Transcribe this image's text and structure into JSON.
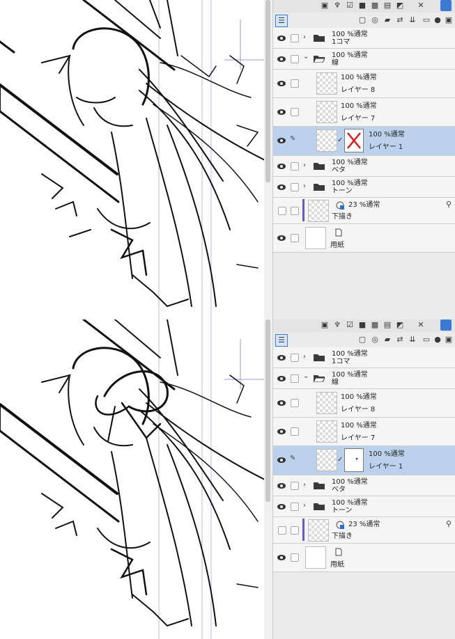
{
  "panels": [
    {
      "id": "before",
      "toggle_x": "✕",
      "layers": [
        {
          "kind": "folder",
          "indent": 0,
          "expanded": false,
          "line1": "100 %通常",
          "line2": "1コマ",
          "selected": false
        },
        {
          "kind": "folder",
          "indent": 0,
          "expanded": true,
          "line1": "100 %通常",
          "line2": "線",
          "selected": false
        },
        {
          "kind": "raster",
          "indent": 1,
          "line1": "100 %通常",
          "line2": "レイヤー 8",
          "selected": false
        },
        {
          "kind": "raster",
          "indent": 1,
          "line1": "100 %通常",
          "line2": "レイヤー 7",
          "selected": false
        },
        {
          "kind": "raster-mask",
          "indent": 1,
          "line1": "100 %通常",
          "line2": "レイヤー 1",
          "selected": true,
          "mask": "x"
        },
        {
          "kind": "folder",
          "indent": 0,
          "expanded": false,
          "line1": "100 %通常",
          "line2": "ベタ",
          "selected": false
        },
        {
          "kind": "folder",
          "indent": 0,
          "expanded": false,
          "line1": "100 %通常",
          "line2": "トーン",
          "selected": false
        },
        {
          "kind": "draft",
          "indent": 0,
          "line1": "23 %通常",
          "line2": "下描き",
          "selected": false
        },
        {
          "kind": "paper",
          "indent": 0,
          "line1": "",
          "line2": "用紙",
          "selected": false
        }
      ]
    },
    {
      "id": "after",
      "layers": [
        {
          "kind": "folder",
          "indent": 0,
          "expanded": false,
          "line1": "100 %通常",
          "line2": "1コマ",
          "selected": false
        },
        {
          "kind": "folder",
          "indent": 0,
          "expanded": true,
          "line1": "100 %通常",
          "line2": "線",
          "selected": false
        },
        {
          "kind": "raster",
          "indent": 1,
          "line1": "100 %通常",
          "line2": "レイヤー 8",
          "selected": false
        },
        {
          "kind": "raster",
          "indent": 1,
          "line1": "100 %通常",
          "line2": "レイヤー 7",
          "selected": false
        },
        {
          "kind": "raster-mask",
          "indent": 1,
          "line1": "100 %通常",
          "line2": "レイヤー 1",
          "selected": true,
          "mask": "dot"
        },
        {
          "kind": "folder",
          "indent": 0,
          "expanded": false,
          "line1": "100 %通常",
          "line2": "ベタ",
          "selected": false
        },
        {
          "kind": "folder",
          "indent": 0,
          "expanded": false,
          "line1": "100 %通常",
          "line2": "トーン",
          "selected": false
        },
        {
          "kind": "draft",
          "indent": 0,
          "line1": "23 %通常",
          "line2": "下描き",
          "selected": false
        },
        {
          "kind": "paper",
          "indent": 0,
          "line1": "",
          "line2": "用紙",
          "selected": false
        }
      ]
    }
  ],
  "icons": {
    "eye": "eye-icon",
    "folder": "folder-icon",
    "chevron_right": "›",
    "chevron_down": "⌄",
    "pencil": "pencil-icon",
    "checkmark": "✓",
    "layer_panel": "layer-panel-icon"
  },
  "colors": {
    "selected_row": "#bcd2ec",
    "mask_x": "#d62020",
    "draft_bar": "#6a5acd"
  }
}
